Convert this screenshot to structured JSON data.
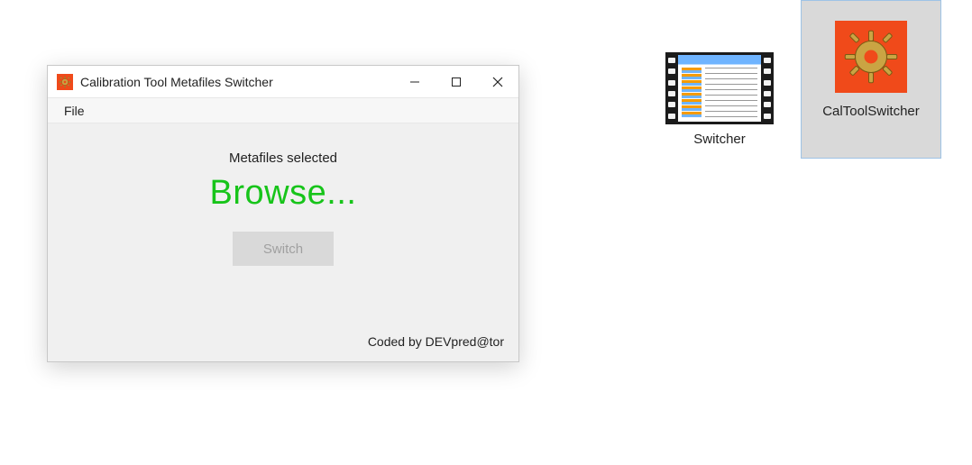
{
  "window": {
    "title": "Calibration Tool Metafiles Switcher",
    "menu": {
      "file": "File"
    },
    "body": {
      "selected_label": "Metafiles selected",
      "browse_label": "Browse...",
      "switch_label": "Switch",
      "footer": "Coded by DEVpred@tor"
    }
  },
  "desktop": {
    "icons": [
      {
        "label": "Switcher"
      },
      {
        "label": "CalToolSwitcher"
      }
    ]
  }
}
